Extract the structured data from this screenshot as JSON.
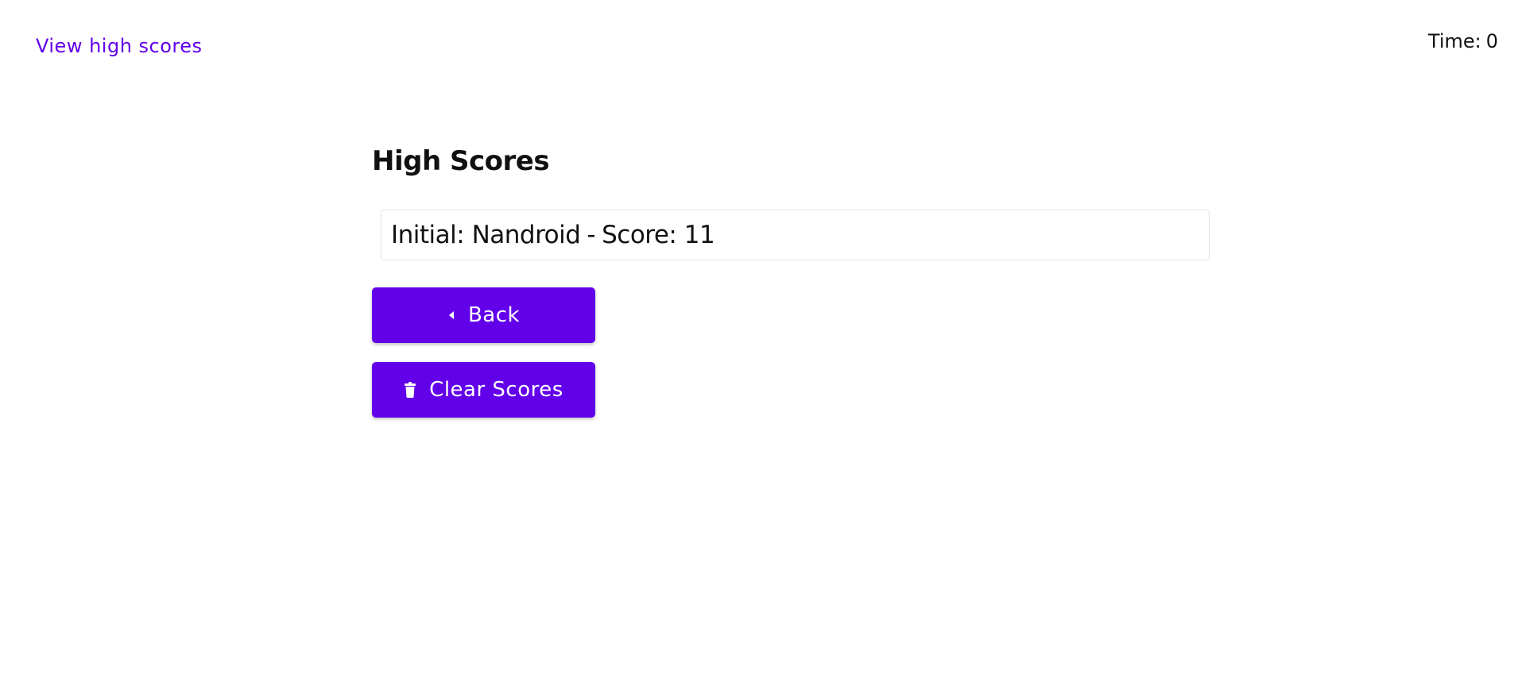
{
  "nav": {
    "view_high_scores": "View high scores"
  },
  "timer": {
    "label": "Time:",
    "value": "0"
  },
  "main": {
    "title": "High Scores",
    "scores": [
      {
        "initial_label": "Initial: Nandroid",
        "separator": "-",
        "score_label": "Score: 11"
      }
    ],
    "buttons": {
      "back_label": "Back",
      "back_icon": "caret-left-icon",
      "clear_label": "Clear Scores",
      "clear_icon": "trash-icon"
    }
  },
  "colors": {
    "accent": "#6200ea",
    "text": "#111111",
    "border": "#e2e2e2",
    "background": "#ffffff"
  }
}
